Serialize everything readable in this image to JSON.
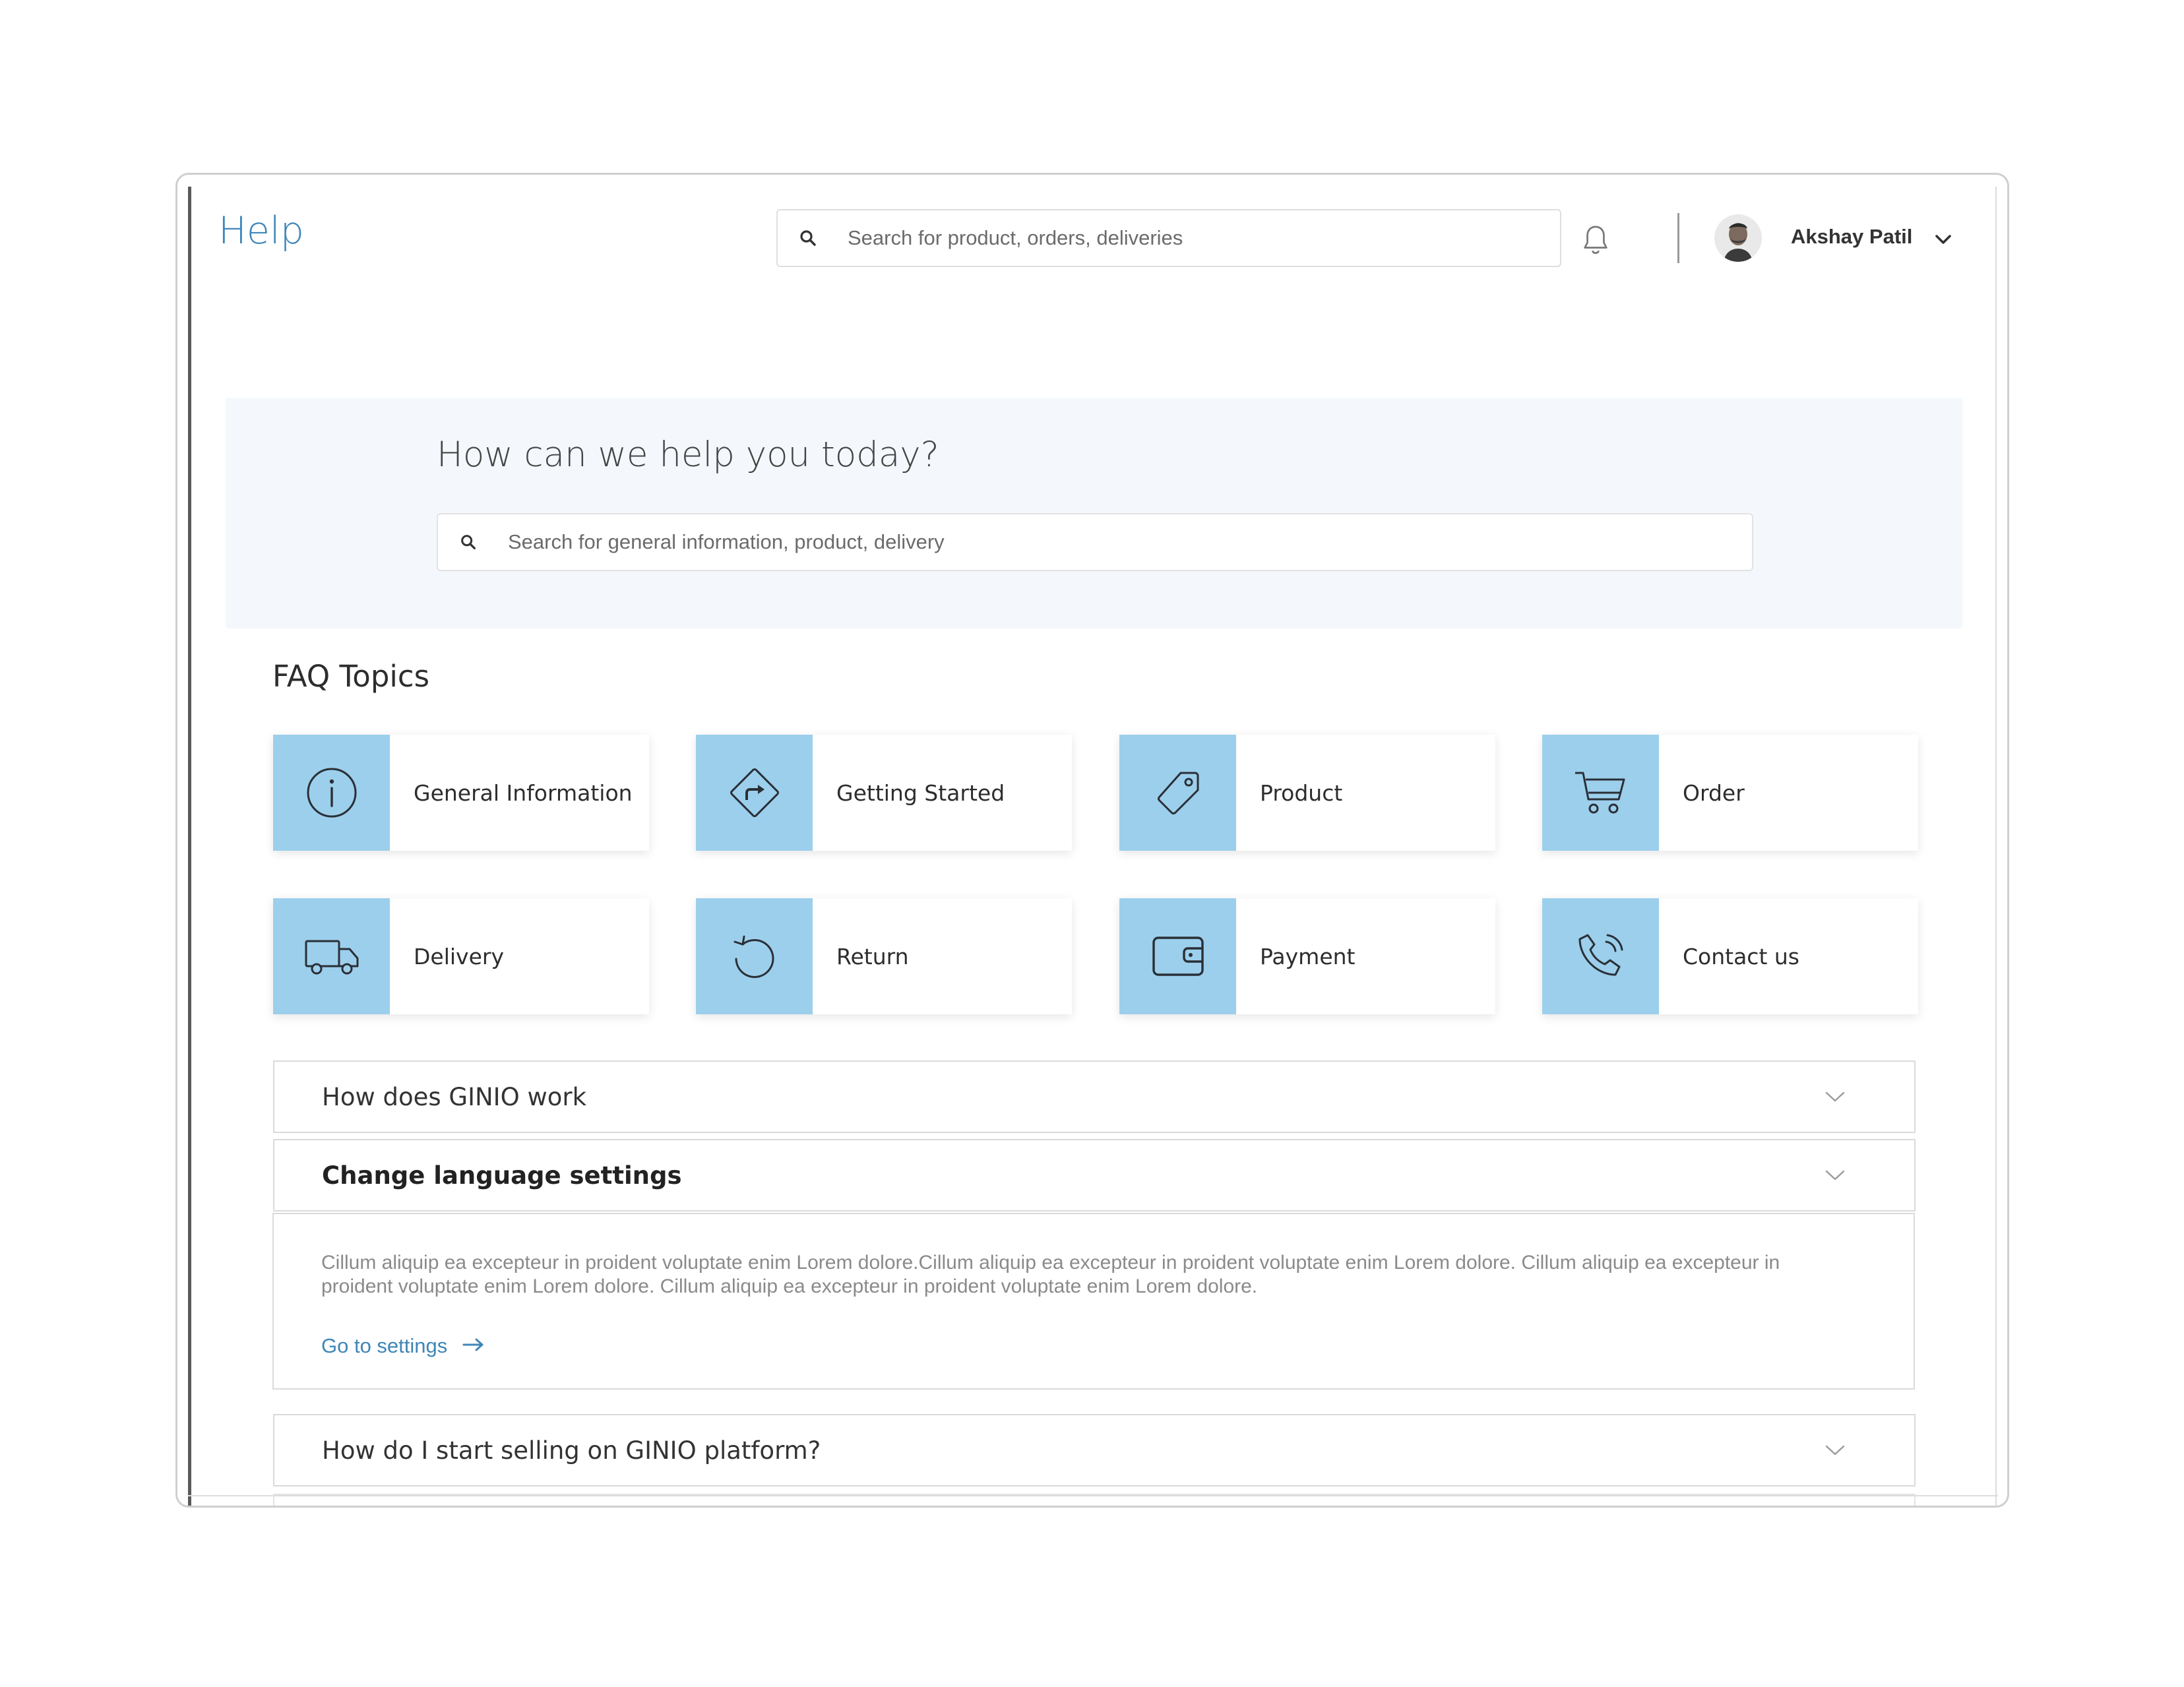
{
  "header": {
    "title": "Help",
    "search_placeholder": "Search for product, orders, deliveries",
    "user_name": "Akshay Patil"
  },
  "hero": {
    "title": "How can we help you today?",
    "search_placeholder": "Search for general information, product, delivery"
  },
  "faq": {
    "heading": "FAQ Topics",
    "topics": [
      {
        "label": "General Information",
        "icon": "info-icon"
      },
      {
        "label": "Getting Started",
        "icon": "direction-sign-icon"
      },
      {
        "label": "Product",
        "icon": "tag-icon"
      },
      {
        "label": "Order",
        "icon": "cart-icon"
      },
      {
        "label": "Delivery",
        "icon": "truck-icon"
      },
      {
        "label": "Return",
        "icon": "return-icon"
      },
      {
        "label": "Payment",
        "icon": "wallet-icon"
      },
      {
        "label": "Contact us",
        "icon": "phone-icon"
      }
    ]
  },
  "accordion": {
    "items": [
      {
        "label": "How does GINIO work",
        "expanded": false
      },
      {
        "label": "Change language settings",
        "expanded": true
      },
      {
        "label": "How do I start selling on GINIO platform?",
        "expanded": false
      }
    ],
    "body_text": "Cillum aliquip ea excepteur in proident voluptate enim Lorem dolore.Cillum aliquip ea excepteur in proident voluptate enim Lorem dolore. Cillum aliquip ea excepteur in proident voluptate enim Lorem dolore. Cillum aliquip ea excepteur in proident voluptate enim Lorem dolore.",
    "link_label": "Go to settings"
  },
  "colors": {
    "accent": "#3f86b8",
    "topic_tile": "#9ccfec",
    "hero_background": "#f4f8fc"
  }
}
